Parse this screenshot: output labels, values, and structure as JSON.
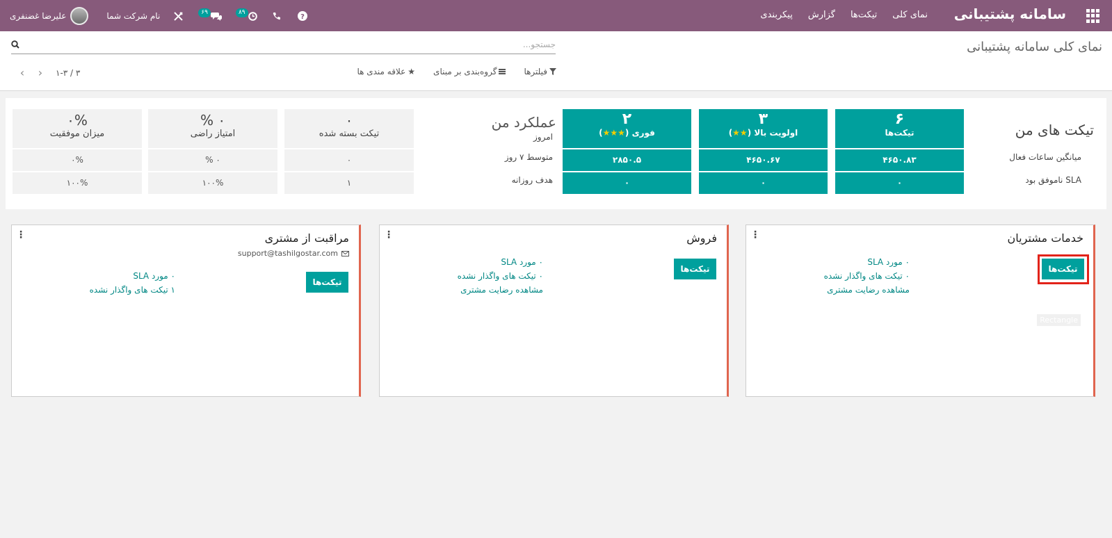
{
  "navbar": {
    "brand": "سامانه پشتیبانی",
    "menu": [
      "نمای کلی",
      "تیکت‌ها",
      "گزارش",
      "پیکربندی"
    ],
    "company": "نام شرکت شما",
    "user": "علیرضا غضنفری",
    "activity_count": "۸۹",
    "messages_count": "۶۹",
    "colors": {
      "bar": "#875a7b",
      "badge": "#00a09d"
    }
  },
  "control": {
    "title": "نمای کلی سامانه پشتیبانی",
    "search_placeholder": "جستجو...",
    "filters_label": "فیلترها",
    "groupby_label": "گروه‌بندی بر مبنای",
    "favorites_label": "علاقه مندی ها",
    "pager": "۱-۳ / ۳"
  },
  "dashboard": {
    "my_tickets_title": "تیکت های من",
    "row_labels": [
      "میانگین ساعات فعال",
      "SLA ناموفق بود"
    ],
    "tiles": [
      {
        "num": "۶",
        "label": "تیکت‌ها",
        "avg": "۴۶۵۰.۸۳",
        "sla": "۰"
      },
      {
        "num": "۳",
        "label": "اولویت بالا (",
        "label_end": ")",
        "stars": "★★",
        "avg": "۴۶۵۰.۶۷",
        "sla": "۰"
      },
      {
        "num": "۲",
        "label": "فوری (",
        "label_end": ")",
        "stars": "★★★",
        "avg": "۲۸۵۰.۵",
        "sla": "۰"
      }
    ],
    "performance_title": "عملکرد من",
    "perf_row_labels": [
      "امروز",
      "متوسط ۷ روز",
      "هدف روزانه"
    ],
    "perf_tiles": [
      {
        "num": "۰",
        "label": "تیکت بسته شده",
        "avg": "۰",
        "target": "۱"
      },
      {
        "num": "۰ %",
        "label": "امتیاز راضی",
        "avg": "۰ %",
        "target": "۱۰۰%"
      },
      {
        "num": "۰%",
        "label": "میزان موفقیت",
        "avg": "۰%",
        "target": "۱۰۰%"
      }
    ]
  },
  "teams": [
    {
      "name": "خدمات مشتریان",
      "button": "تیکت‌ها",
      "links": [
        "۰ مورد SLA",
        "۰ تیکت های واگذار نشده",
        "مشاهده رضایت مشتری"
      ],
      "tag": "Rectangle"
    },
    {
      "name": "فروش",
      "button": "تیکت‌ها",
      "links": [
        "۰ مورد SLA",
        "۰ تیکت های واگذار نشده",
        "مشاهده رضایت مشتری"
      ]
    },
    {
      "name": "مراقبت از مشتری",
      "email": "support@tashilgostar.com",
      "button": "تیکت‌ها",
      "links": [
        "۰ مورد SLA",
        "۱ تیکت های واگذار نشده"
      ]
    }
  ],
  "icons": [
    "apps-icon",
    "help-icon",
    "phone-icon",
    "activity-clock-icon",
    "chat-icon",
    "debug-icon",
    "search-icon",
    "filter-icon",
    "list-icon",
    "star-icon",
    "envelope-icon",
    "kebab-menu-icon"
  ]
}
